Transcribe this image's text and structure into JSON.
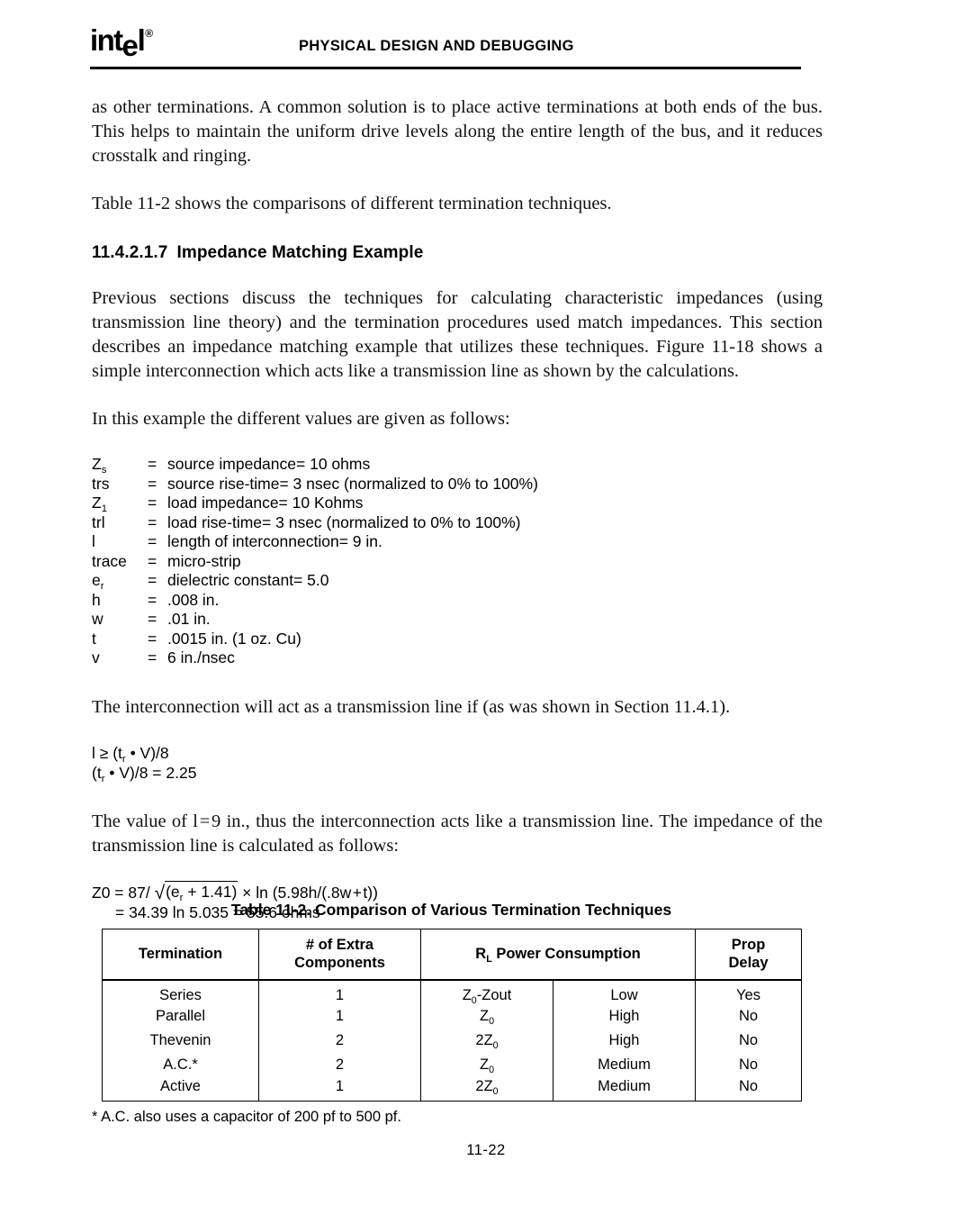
{
  "header": {
    "logo_text": "int",
    "logo_e": "e",
    "logo_l": "l",
    "logo_reg": "®",
    "title": "PHYSICAL DESIGN AND DEBUGGING"
  },
  "body": {
    "para1": "as other terminations. A common solution is to place active terminations at both ends of the bus. This helps to maintain the uniform drive levels along the entire length of the bus, and it reduces crosstalk and ringing.",
    "para2": "Table 11-2 shows the comparisons of different termination techniques.",
    "heading_number": "11.4.2.1.7",
    "heading_text": "Impedance Matching Example",
    "para3": "Previous sections discuss the techniques for calculating characteristic impedances (using transmission line theory) and the termination procedures used match impedances. This section describes an impedance matching example that utilizes these techniques. Figure 11-18 shows a simple interconnection which acts like a transmission line as shown by the calculations.",
    "para4": "In this example the different values are given as follows:",
    "para5": "The interconnection will act as a transmission line if (as was shown in Section 11.4.1).",
    "para6": "The value of l = 9 in., thus the interconnection acts like a transmission line. The impedance of the transmission line is calculated as follows:"
  },
  "variables": [
    {
      "symbol": "Z",
      "sub": "s",
      "eq": "=",
      "desc": "source impedance=  10 ohms"
    },
    {
      "symbol": "trs",
      "sub": "",
      "eq": "=",
      "desc": "source rise-time=  3 nsec (normalized to 0% to 100%)"
    },
    {
      "symbol": "Z",
      "sub": "1",
      "eq": "=",
      "desc": "load impedance=  10 Kohms"
    },
    {
      "symbol": "trl",
      "sub": "",
      "eq": "=",
      "desc": "load rise-time=  3 nsec (normalized to 0% to 100%)"
    },
    {
      "symbol": "l",
      "sub": "",
      "eq": "=",
      "desc": "length of interconnection=  9 in."
    },
    {
      "symbol": "trace",
      "sub": "",
      "eq": "=",
      "desc": "micro-strip"
    },
    {
      "symbol": "e",
      "sub": "r",
      "eq": "=",
      "desc": "dielectric constant=  5.0"
    },
    {
      "symbol": "h",
      "sub": "",
      "eq": "=",
      "desc": ".008 in."
    },
    {
      "symbol": "w",
      "sub": "",
      "eq": "=",
      "desc": ".01 in."
    },
    {
      "symbol": "t",
      "sub": "",
      "eq": "=",
      "desc": ".0015 in. (1 oz. Cu)"
    },
    {
      "symbol": "v",
      "sub": "",
      "eq": "=",
      "desc": "6 in./nsec"
    }
  ],
  "formulas": {
    "cond_line1_a": "l ≥ (t",
    "cond_line1_sub": "r",
    "cond_line1_b": " • V)/8",
    "cond_line2_a": "(t",
    "cond_line2_sub": "r",
    "cond_line2_b": " • V)/8  =  2.25",
    "z0_prefix": "Z0  =  87/ ",
    "z0_radicand_a": "(e",
    "z0_radicand_sub": "r",
    "z0_radicand_b": " + 1.41)",
    "z0_suffix": " × ln (5.98h/(.8w + t))",
    "z0_line2": "=  34.39 ln 5.035  =  55.6 ohms"
  },
  "table": {
    "title": "Table 11-2.  Comparison of Various Termination Techniques",
    "headers": {
      "termination": "Termination",
      "extra_line1": "# of Extra",
      "extra_line2": "Components",
      "power_prefix": "R",
      "power_sub": "L",
      "power_suffix": " Power Consumption",
      "prop_line1": "Prop",
      "prop_line2": "Delay"
    },
    "rows": [
      {
        "termination": "Series",
        "extra": "1",
        "z_a": "Z",
        "z_sub": "0",
        "z_b": "-Zout",
        "z_pre": "",
        "power": "Low",
        "prop": "Yes"
      },
      {
        "termination": "Parallel",
        "extra": "1",
        "z_a": "Z",
        "z_sub": "0",
        "z_b": "",
        "z_pre": "",
        "power": "High",
        "prop": "No"
      },
      {
        "termination": "Thevenin",
        "extra": "2",
        "z_a": "Z",
        "z_sub": "0",
        "z_b": "",
        "z_pre": "2",
        "power": "High",
        "prop": "No"
      },
      {
        "termination": "A.C.*",
        "extra": "2",
        "z_a": "Z",
        "z_sub": "0",
        "z_b": "",
        "z_pre": "",
        "power": "Medium",
        "prop": "No"
      },
      {
        "termination": "Active",
        "extra": "1",
        "z_a": "Z",
        "z_sub": "0",
        "z_b": "",
        "z_pre": "2",
        "power": "Medium",
        "prop": "No"
      }
    ],
    "footnote": "* A.C. also uses a capacitor of 200 pf to 500 pf."
  },
  "page_number": "11-22"
}
